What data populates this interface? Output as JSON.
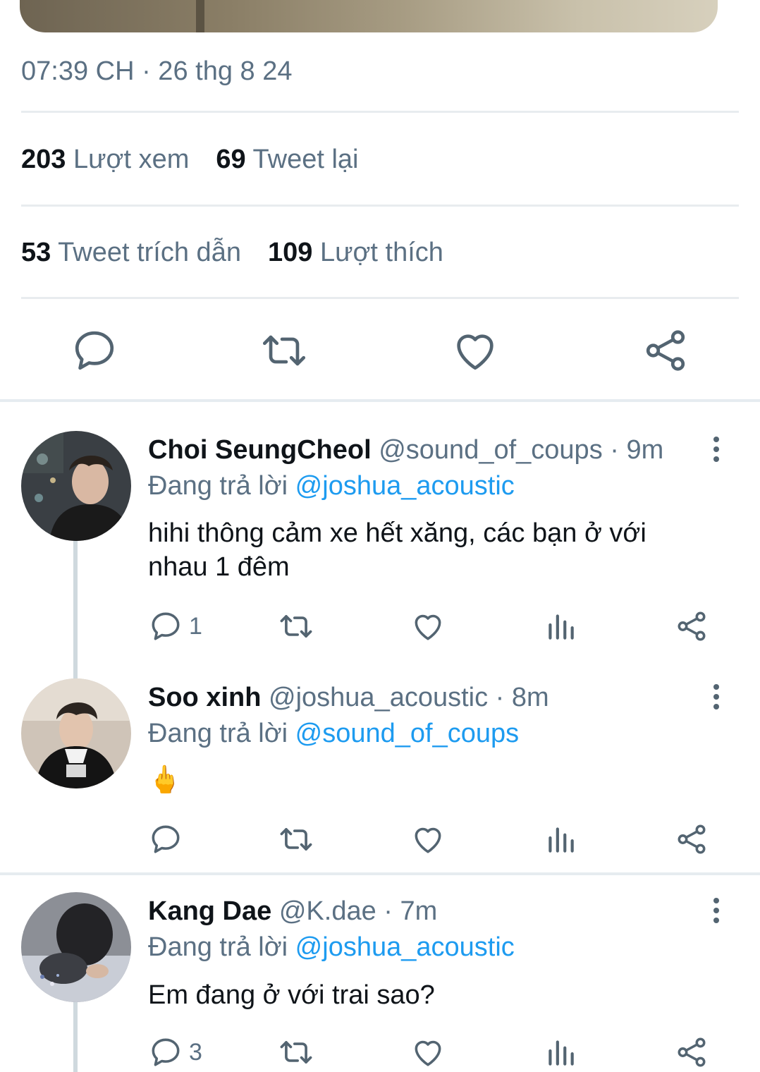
{
  "tweet_detail": {
    "timestamp": "07:39 CH · 26 thg 8 24",
    "views_count": "203",
    "views_label": "Lượt xem",
    "retweets_count": "69",
    "retweets_label": "Tweet lại",
    "quotes_count": "53",
    "quotes_label": "Tweet trích dẫn",
    "likes_count": "109",
    "likes_label": "Lượt thích",
    "actions": [
      "reply-icon",
      "retweet-icon",
      "like-icon",
      "share-icon"
    ]
  },
  "replies": [
    {
      "name": "Choi SeungCheol",
      "handle": "@sound_of_coups",
      "time": "· 9m",
      "replying_prefix": "Đang trả lời",
      "replying_to": "@joshua_acoustic",
      "text": "hihi thông cảm xe hết xăng, các bạn ở với nhau 1 đêm",
      "reply_count": "1"
    },
    {
      "name": "Soo xinh",
      "handle": "@joshua_acoustic",
      "time": "· 8m",
      "replying_prefix": "Đang trả lời",
      "replying_to": "@sound_of_coups",
      "text": "🖕",
      "reply_count": ""
    },
    {
      "name": "Kang Dae",
      "handle": "@K.dae",
      "time": "· 7m",
      "replying_prefix": "Đang trả lời",
      "replying_to": "@joshua_acoustic",
      "text": "Em đang ở với trai sao?",
      "reply_count": "3"
    }
  ],
  "colors": {
    "accent": "#1d9bf0",
    "secondary_text": "#5b7083",
    "icon": "#536471",
    "divider": "#e8ecef"
  }
}
